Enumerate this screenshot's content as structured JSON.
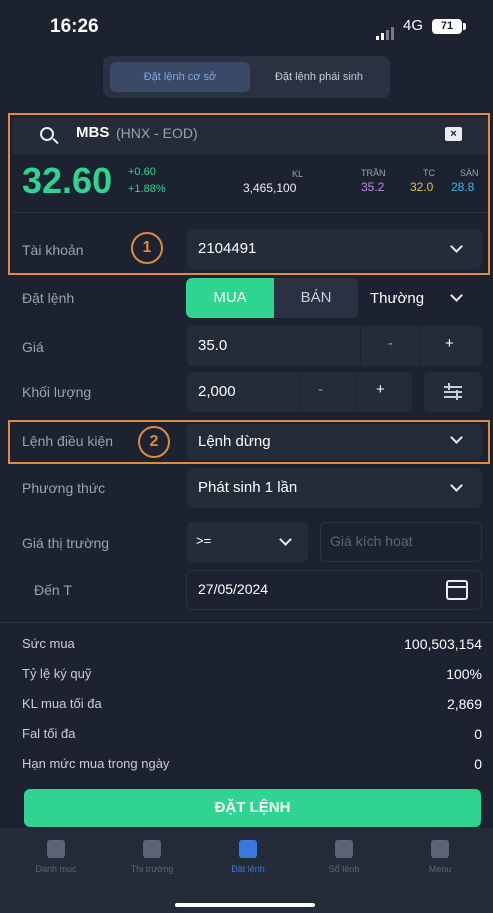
{
  "status": {
    "time": "16:26",
    "network": "4G",
    "battery": "71"
  },
  "segment": {
    "tab_stock": "Đặt lệnh cơ sở",
    "tab_derivative": "Đặt lệnh phái sinh"
  },
  "quote": {
    "ticker": "MBS",
    "exchange": "(HNX - EOD)",
    "price": "32.60",
    "change": "+0.60",
    "change_pct": "+1.88%",
    "kl_label": "KL",
    "kl_value": "3,465,100",
    "tran_label": "TRẦN",
    "tran_value": "35.2",
    "tc_label": "TC",
    "tc_value": "32.0",
    "san_label": "SÀN",
    "san_value": "28.8"
  },
  "annotations": {
    "marker1": "1",
    "marker2": "2"
  },
  "form": {
    "account_label": "Tài khoản",
    "account_value": "2104491",
    "order_label": "Đặt lệnh",
    "buy": "MUA",
    "sell": "BÁN",
    "order_type": "Thường",
    "price_label": "Giá",
    "price_value": "35.0",
    "qty_label": "Khối lượng",
    "qty_value": "2,000",
    "minus": "-",
    "plus": "+",
    "cond_label": "Lệnh điều kiện",
    "cond_value": "Lệnh dừng",
    "method_label": "Phương thức",
    "method_value": "Phát sinh 1 lần",
    "market_label": "Giá thị trường",
    "operator": ">=",
    "trigger_placeholder": "Giá kích hoạt",
    "until_label": "Đến T",
    "until_value": "27/05/2024"
  },
  "info": [
    {
      "label": "Sức mua",
      "value": "100,503,154"
    },
    {
      "label": "Tỷ lệ ký quỹ",
      "value": "100%"
    },
    {
      "label": "KL mua tối đa",
      "value": "2,869"
    },
    {
      "label": "Fal tối đa",
      "value": "0"
    },
    {
      "label": "Hạn mức mua trong ngày",
      "value": "0"
    }
  ],
  "submit": "ĐẶT LỆNH",
  "tabs": [
    {
      "label": "Danh mục"
    },
    {
      "label": "Thị trường"
    },
    {
      "label": "Đặt lệnh"
    },
    {
      "label": "Sổ lệnh"
    },
    {
      "label": "Menu"
    }
  ],
  "colors": {
    "accent": "#2ed48f",
    "highlight": "#e08a3c",
    "active_tab": "#3a78e0"
  }
}
